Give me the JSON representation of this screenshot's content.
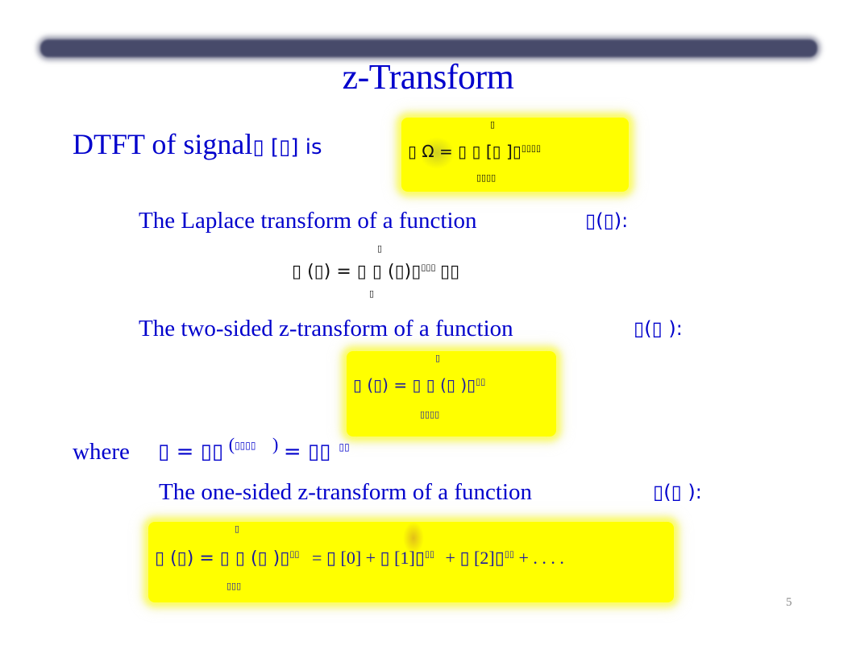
{
  "slide": {
    "title": "z-Transform",
    "page_number": "5"
  },
  "dtft": {
    "intro": "DTFT of signal",
    "intro_sym": "▯ [▯] is",
    "formula": {
      "upper_limit": "▯",
      "main": "▯   Ω   =    ▯  ▯     [▯ ]▯",
      "exponent": "▯▯▯▯",
      "lower_limit": "▯▯▯▯"
    }
  },
  "laplace": {
    "heading": "The Laplace transform of a function",
    "func": "▯(▯):",
    "formula": {
      "upper_limit": "▯",
      "main": "▯ (▯) =  ▯      ▯ (▯)▯",
      "exponent": "▯▯▯",
      "tail": "▯▯",
      "lower_limit": "▯"
    }
  },
  "two_sided": {
    "heading": "The two-sided z-transform of a function",
    "func": "▯(▯ ):",
    "formula": {
      "upper_limit": "▯",
      "main": "▯ (▯) =    ▯  ▯     (▯ )▯",
      "exponent": "▯▯",
      "lower_limit": "▯▯▯▯"
    }
  },
  "where": {
    "label": "where",
    "expr_a": "▯  =  ▯▯",
    "paren_open": "(",
    "paren_exp": "▯▯▯▯",
    "paren_close": ")",
    "expr_b": "=  ▯▯",
    "exp_b": "▯▯"
  },
  "one_sided": {
    "heading": "The one-sided z-transform of a function",
    "func": "▯(▯ ):",
    "formula": {
      "upper_limit": "▯",
      "main_a": "▯ (▯) =  ▯ ▯     (▯ )▯",
      "exp_a": "▯▯",
      "main_b": "=  ▯ [0] +  ▯ [1]▯",
      "exp_b": "▯▯",
      "main_c": "+  ▯ [2]▯",
      "exp_c": "▯▯",
      "main_d": "+ . . . .",
      "lower_limit": "▯▯▯"
    }
  }
}
